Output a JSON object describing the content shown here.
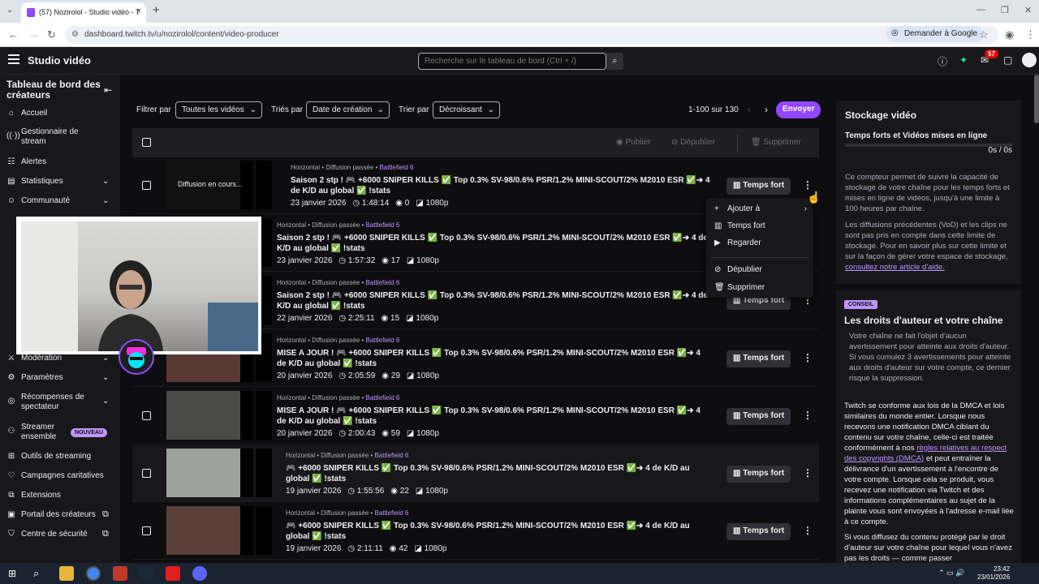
{
  "browser": {
    "tab_title": "(57) Nozirolol - Studio vidéo - T",
    "url": "dashboard.twitch.tv/u/nozirolol/content/video-producer",
    "translate_label": "Demander à Google"
  },
  "topbar": {
    "app_title": "Studio vidéo",
    "search_placeholder": "Recherche sur le tableau de bord (Ctrl + /)",
    "notification_count": "57"
  },
  "sidebar": {
    "title": "Tableau de bord des créateurs",
    "items": [
      {
        "label": "Accueil",
        "icon": "home-icon"
      },
      {
        "label": "Gestionnaire de stream",
        "icon": "stream-icon"
      },
      {
        "label": "Alertes",
        "icon": "alert-icon"
      },
      {
        "label": "Statistiques",
        "icon": "stats-icon"
      },
      {
        "label": "Communauté",
        "icon": "community-icon"
      },
      {
        "label": "Modération",
        "icon": "moderation-icon"
      },
      {
        "label": "Paramètres",
        "icon": "settings-icon"
      },
      {
        "label": "Récompenses de spectateur",
        "icon": "rewards-icon"
      },
      {
        "label": "Streamer ensemble",
        "icon": "together-icon"
      },
      {
        "label": "Outils de streaming",
        "icon": "tools-icon"
      },
      {
        "label": "Campagnes caritatives",
        "icon": "charity-icon"
      },
      {
        "label": "Extensions",
        "icon": "extensions-icon"
      },
      {
        "label": "Portail des créateurs",
        "icon": "portal-icon"
      },
      {
        "label": "Centre de sécurité",
        "icon": "security-icon"
      }
    ],
    "new_badge": "NOUVEAU"
  },
  "filters": {
    "filter_label": "Filtrer par",
    "filter_value": "Toutes les vidéos",
    "sorted_label": "Triés par",
    "sorted_value": "Date de création",
    "order_label": "Trier par",
    "order_value": "Décroissant",
    "pagination": "1-100 sur 130",
    "upload_button": "Envoyer"
  },
  "list_actions": {
    "publish": "Publier",
    "unpublish": "Dépublier",
    "delete": "Supprimer"
  },
  "videos": [
    {
      "meta_prefix": "Horizontal • Diffusion passée • ",
      "game": "Battlefield 6",
      "title": "Saison 2 stp ! 🎮 +6000 SNIPER KILLS ✅ Top 0.3% SV-98/0.6% PSR/1.2% MINI-SCOUT/2% M2010 ESR ✅➔ 4 de K/D au global ✅ !stats",
      "date": "23 janvier 2026",
      "duration": "1:48:14",
      "views": "0",
      "quality": "1080p",
      "thumb_text": "Diffusion en cours..."
    },
    {
      "meta_prefix": "Horizontal • Diffusion passée • ",
      "game": "Battlefield 6",
      "title": "Saison 2 stp ! 🎮 +6000 SNIPER KILLS ✅ Top 0.3% SV-98/0.6% PSR/1.2% MINI-SCOUT/2% M2010 ESR ✅➔ 4 de K/D au global ✅ !stats",
      "date": "23 janvier 2026",
      "duration": "1:57:32",
      "views": "17",
      "quality": "1080p"
    },
    {
      "meta_prefix": "Horizontal • Diffusion passée • ",
      "game": "Battlefield 6",
      "title": "Saison 2 stp ! 🎮 +6000 SNIPER KILLS ✅ Top 0.3% SV-98/0.6% PSR/1.2% MINI-SCOUT/2% M2010 ESR ✅➔ 4 de K/D au global ✅ !stats",
      "date": "22 janvier 2026",
      "duration": "2:25:11",
      "views": "15",
      "quality": "1080p"
    },
    {
      "meta_prefix": "Horizontal • Diffusion passée • ",
      "game": "Battlefield 6",
      "title": "MISE A JOUR ! 🎮 +6000 SNIPER KILLS ✅ Top 0.3% SV-98/0.6% PSR/1.2% MINI-SCOUT/2% M2010 ESR ✅➔ 4 de K/D au global ✅ !stats",
      "date": "20 janvier 2026",
      "duration": "2:05:59",
      "views": "29",
      "quality": "1080p"
    },
    {
      "meta_prefix": "Horizontal • Diffusion passée • ",
      "game": "Battlefield 6",
      "title": "MISE A JOUR ! 🎮 +6000 SNIPER KILLS ✅ Top 0.3% SV-98/0.6% PSR/1.2% MINI-SCOUT/2% M2010 ESR ✅➔ 4 de K/D au global ✅ !stats",
      "date": "20 janvier 2026",
      "duration": "2:00:43",
      "views": "59",
      "quality": "1080p"
    },
    {
      "meta_prefix": "Horizontal • Diffusion passée • ",
      "game": "Battlefield 6",
      "title": "🎮 +6000 SNIPER KILLS ✅ Top 0.3% SV-98/0.6% PSR/1.2% MINI-SCOUT/2% M2010 ESR ✅➔ 4 de K/D au global ✅ !stats",
      "date": "19 janvier 2026",
      "duration": "1:55:56",
      "views": "22",
      "quality": "1080p"
    },
    {
      "meta_prefix": "Horizontal • Diffusion passée • ",
      "game": "Battlefield 6",
      "title": "🎮 +6000 SNIPER KILLS ✅ Top 0.3% SV-98/0.6% PSR/1.2% MINI-SCOUT/2% M2010 ESR ✅➔ 4 de K/D au global ✅ !stats",
      "date": "19 janvier 2026",
      "duration": "2:11:11",
      "views": "42",
      "quality": "1080p"
    }
  ],
  "highlight_label": "Temps fort",
  "context_menu": {
    "add_to": "Ajouter à",
    "highlight": "Temps fort",
    "watch": "Regarder",
    "unpublish": "Dépublier",
    "delete": "Supprimer"
  },
  "storage": {
    "title": "Stockage vidéo",
    "subtitle": "Temps forts et Vidéos mises en ligne",
    "usage": "0s / 0s",
    "usage_fraction": 0,
    "desc1": "Ce compteur permet de suivre la capacité de stockage de votre chaîne pour les temps forts et mises en ligne de vidéos, jusqu'à une limite à 100 heures par chaîne.",
    "desc2": "Les diffusions précédentes (VoD) et les clips ne sont pas pris en compte dans cette limite de stockage. Pour en savoir plus sur cette limite et sur la façon de gérer votre espace de stockage, ",
    "desc2_link": "consultez notre article d'aide."
  },
  "copyright": {
    "badge": "CONSEIL",
    "title": "Les droits d'auteur et votre chaîne",
    "box": "Votre chaîne ne fait l'objet d'aucun avertissement pour atteinte aux droits d'auteur. Si vous cumulez 3 avertissements pour atteinte aux droits d'auteur sur votre compte, ce dernier risque la suppression.",
    "p2_before": "Twitch se conforme aux lois de la DMCA et lois similaires du monde entier. Lorsque nous recevons une notification DMCA ciblant du contenu sur votre chaîne, celle-ci est traitée conformément à nos ",
    "p2_link": "règles relatives au respect des copyrights (DMCA)",
    "p2_after": " et peut entraîner la délivrance d'un avertissement à l'encontre de votre compte. Lorsque cela se produit, vous recevez une notification via Twitch et des informations complémentaires au sujet de la plainte vous sont envoyées à l'adresse e-mail liée à ce compte.",
    "p3": "Si vous diffusez du contenu protégé par le droit d'auteur sur votre chaîne pour lequel vous n'avez pas les droits — comme passer"
  },
  "taskbar": {
    "time": "23:42",
    "date": "23/01/2026"
  },
  "colors": {
    "accent": "#9146ff",
    "accent_light": "#bf94ff",
    "background": "#0e0e10",
    "panel": "#18181b",
    "notification": "#eb0400"
  }
}
